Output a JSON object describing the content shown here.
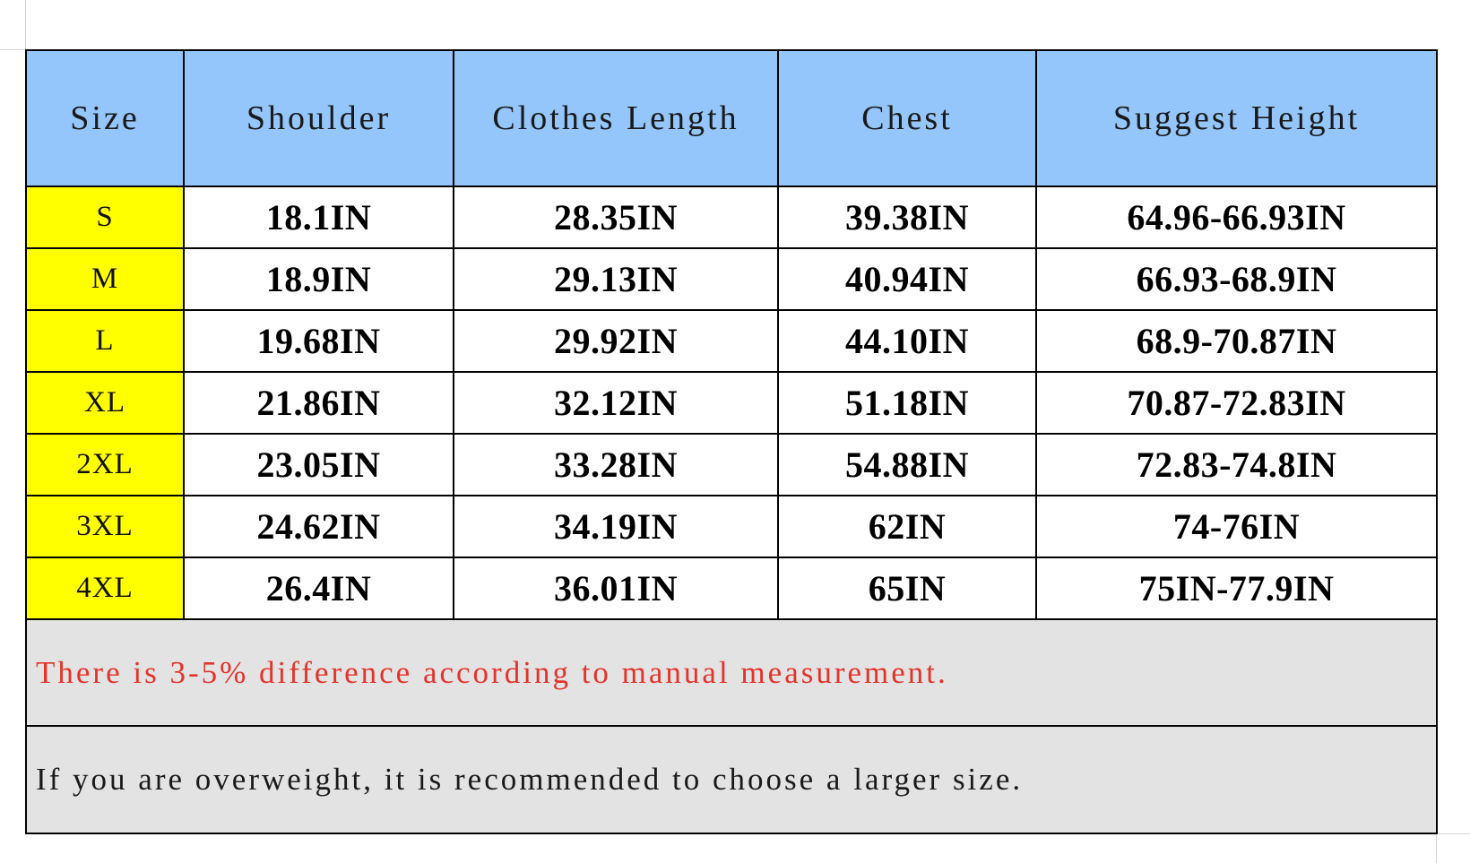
{
  "table": {
    "columns": [
      {
        "key": "size",
        "label": "Size"
      },
      {
        "key": "shoulder",
        "label": "Shoulder"
      },
      {
        "key": "length",
        "label": "Clothes Length"
      },
      {
        "key": "chest",
        "label": "Chest"
      },
      {
        "key": "height",
        "label": "Suggest Height"
      }
    ],
    "rows": [
      {
        "size": "S",
        "shoulder": "18.1IN",
        "length": "28.35IN",
        "chest": "39.38IN",
        "height": "64.96-66.93IN"
      },
      {
        "size": "M",
        "shoulder": "18.9IN",
        "length": "29.13IN",
        "chest": "40.94IN",
        "height": "66.93-68.9IN"
      },
      {
        "size": "L",
        "shoulder": "19.68IN",
        "length": "29.92IN",
        "chest": "44.10IN",
        "height": "68.9-70.87IN"
      },
      {
        "size": "XL",
        "shoulder": "21.86IN",
        "length": "32.12IN",
        "chest": "51.18IN",
        "height": "70.87-72.83IN"
      },
      {
        "size": "2XL",
        "shoulder": "23.05IN",
        "length": "33.28IN",
        "chest": "54.88IN",
        "height": "72.83-74.8IN"
      },
      {
        "size": "3XL",
        "shoulder": "24.62IN",
        "length": "34.19IN",
        "chest": "62IN",
        "height": "74-76IN"
      },
      {
        "size": "4XL",
        "shoulder": "26.4IN",
        "length": "36.01IN",
        "chest": "65IN",
        "height": "75IN-77.9IN"
      }
    ],
    "notes": [
      {
        "text": "There is 3-5% difference according to manual measurement.",
        "color": "#e4332a"
      },
      {
        "text": "If you are overweight, it is recommended to choose a larger size.",
        "color": "#1a1a1a"
      }
    ]
  },
  "colors": {
    "header_background": "#94c6fb",
    "size_background": "#ffff00",
    "note_background": "#e3e3e3",
    "note_red": "#e4332a",
    "border": "#000000"
  }
}
